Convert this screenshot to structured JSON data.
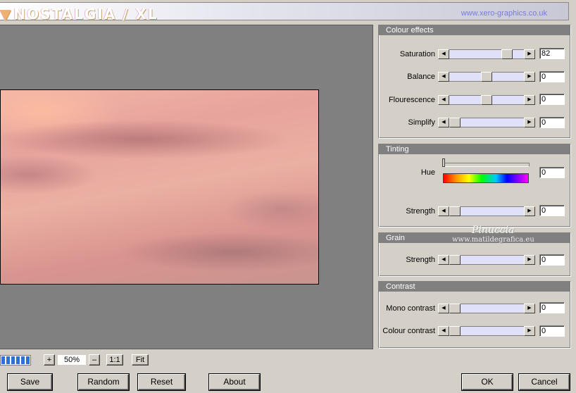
{
  "header": {
    "logo_mark": "▼",
    "logo_text": "NOSTALGIA / XL",
    "website": "www.xero-graphics.co.uk"
  },
  "zoom": {
    "progress": 1.0,
    "plus_label": "+",
    "value": "50%",
    "minus_label": "–",
    "one_to_one_label": "1:1",
    "fit_label": "Fit"
  },
  "buttons": {
    "save": "Save",
    "random": "Random",
    "reset": "Reset",
    "about": "About",
    "ok": "OK",
    "cancel": "Cancel"
  },
  "colour_effects": {
    "title": "Colour effects",
    "saturation": {
      "label": "Saturation",
      "value": "82",
      "level": 0.82
    },
    "balance": {
      "label": "Balance",
      "value": "0",
      "level": 0.5
    },
    "flourescence": {
      "label": "Flourescence",
      "value": "0",
      "level": 0.5
    },
    "simplify": {
      "label": "Simplify",
      "value": "0",
      "level": 0.0
    }
  },
  "tinting": {
    "title": "Tinting",
    "hue": {
      "label": "Hue",
      "value": "0",
      "level": 0.0
    },
    "strength": {
      "label": "Strength",
      "value": "0",
      "level": 0.0
    }
  },
  "grain": {
    "title": "Grain",
    "strength": {
      "label": "Strength",
      "value": "0",
      "level": 0.0
    }
  },
  "contrast": {
    "title": "Contrast",
    "mono": {
      "label": "Mono contrast",
      "value": "0",
      "level": 0.0
    },
    "colour": {
      "label": "Colour contrast",
      "value": "0",
      "level": 0.0
    }
  },
  "watermark": {
    "line1": "Pinuccia",
    "line2": "www.matildegrafica.eu"
  }
}
